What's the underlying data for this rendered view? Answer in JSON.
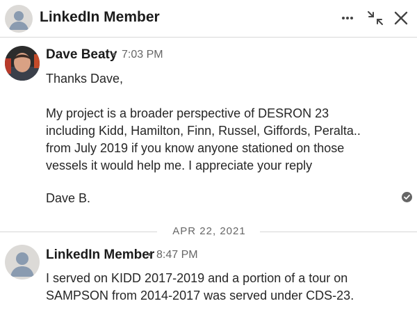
{
  "conversation": {
    "title": "LinkedIn Member",
    "actions": [
      "more-options-icon",
      "minimize-icon",
      "close-icon"
    ]
  },
  "messages": [
    {
      "sender": "Dave Beaty",
      "time": "7:03 PM",
      "lines": [
        "Thanks Dave,",
        "My project is a broader perspective of DESRON 23",
        "including Kidd, Hamilton, Finn, Russel, Giffords, Peralta..",
        "from July 2019 if you know anyone stationed on those",
        "vessels it would help me. I appreciate your reply",
        "Dave B."
      ],
      "status_icon": "seen-check-icon"
    },
    {
      "sender": "LinkedIn Member",
      "time": "8:47 PM",
      "lines": [
        "I served on KIDD 2017-2019 and a portion of a tour on",
        "SAMPSON from 2014-2017 was served under CDS-23."
      ]
    }
  ],
  "date_separator": "APR 22, 2021",
  "separator_dot": "•",
  "colors": {
    "accent": "#1b1b1b",
    "muted": "#666666",
    "divider": "#d6d6d6",
    "avatar_placeholder": "#dcdad7",
    "person_silhouette": "#8a9bb0"
  }
}
